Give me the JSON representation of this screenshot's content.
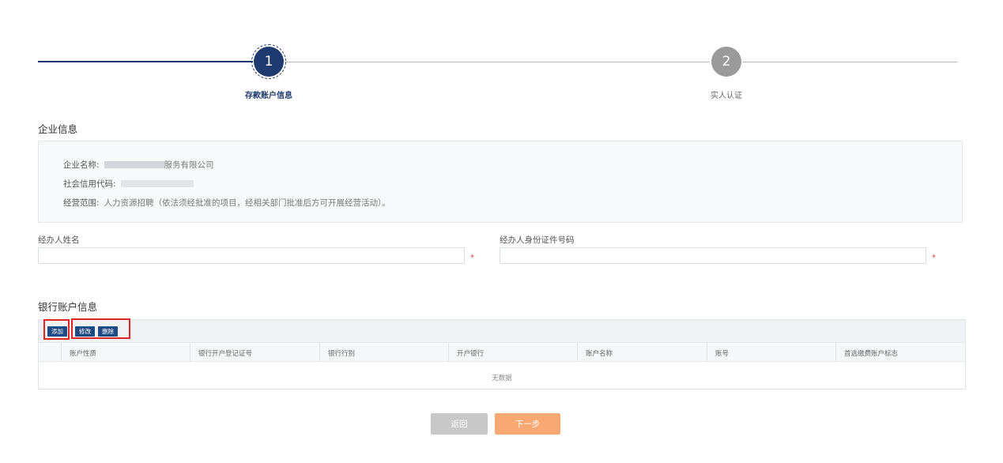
{
  "stepper": {
    "steps": [
      {
        "number": "1",
        "label": "存款账户信息",
        "active": true
      },
      {
        "number": "2",
        "label": "实人认证",
        "active": false
      }
    ],
    "active_color": "#1f3a6e",
    "inactive_color": "#9a9a9a"
  },
  "company": {
    "section_title": "企业信息",
    "name_label": "企业名称:",
    "name_value_visible": "服务有限公司",
    "credit_code_label": "社会信用代码:",
    "scope_label": "经营范围:",
    "scope_value": "人力资源招聘（依法须经批准的项目，经相关部门批准后方可开展经营活动）。"
  },
  "form": {
    "agent_name_label": "经办人姓名",
    "agent_name_value": "",
    "agent_id_label": "经办人身份证件号码",
    "agent_id_value": "",
    "required_mark": "*"
  },
  "bank": {
    "section_title": "银行账户信息",
    "add_label": "添加",
    "edit_label": "修改",
    "delete_label": "删除",
    "columns": [
      "账户性质",
      "银行开户登记证号",
      "银行行别",
      "开户银行",
      "账户名称",
      "账号",
      "首选缴费账户标志"
    ],
    "empty_text": "无数据"
  },
  "footer": {
    "back_label": "返回",
    "next_label": "下一步",
    "back_color": "#c8c8c8",
    "next_color": "#f8a870"
  }
}
